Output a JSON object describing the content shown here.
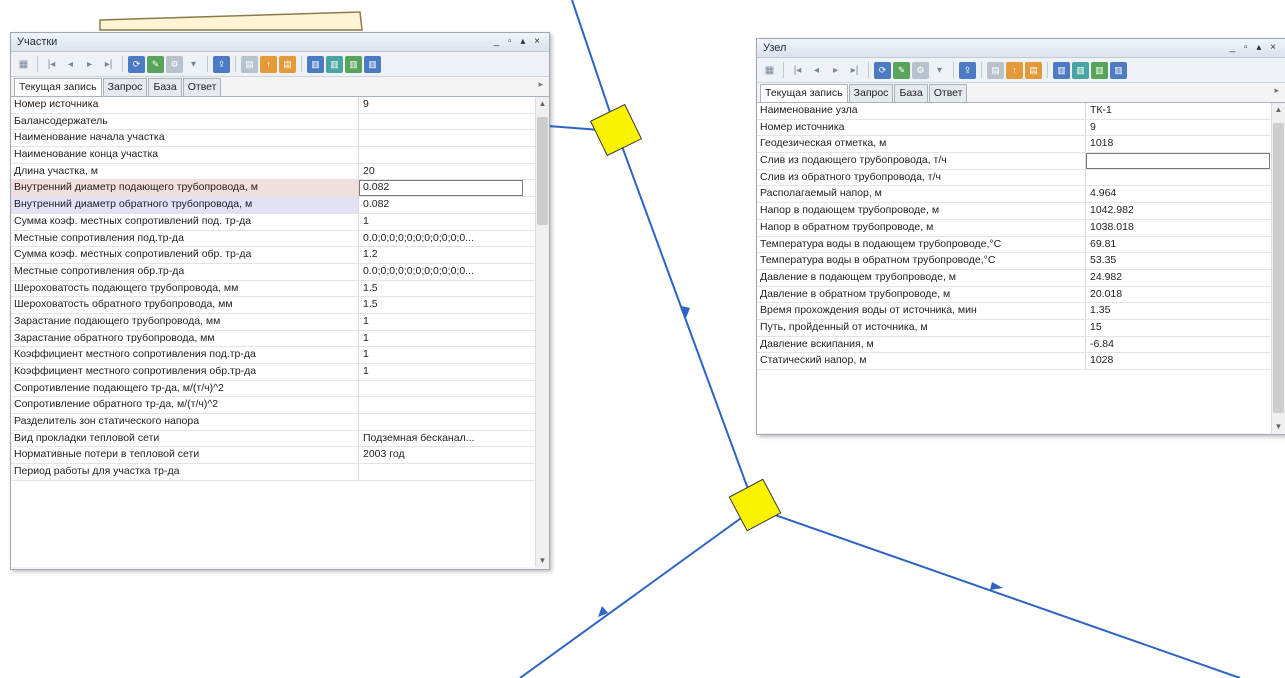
{
  "uchastki": {
    "title": "Участки",
    "controls": "_ ▫ ▴ ×",
    "tabs": [
      "Текущая запись",
      "Запрос",
      "База",
      "Ответ"
    ],
    "rows": [
      {
        "name": "Номер источника",
        "value": "9"
      },
      {
        "name": "Балансодержатель",
        "value": ""
      },
      {
        "name": "Наименование начала участка",
        "value": ""
      },
      {
        "name": "Наименование конца участка",
        "value": ""
      },
      {
        "name": "Длина участка, м",
        "value": "20"
      },
      {
        "name": "Внутренний диаметр подающего трубопровода, м",
        "value": "0.082"
      },
      {
        "name": "Внутренний диаметр обратного трубопровода, м",
        "value": "0.082"
      },
      {
        "name": "Сумма коэф. местных сопротивлений под. тр-да",
        "value": "1"
      },
      {
        "name": "Местные сопротивления под.тр-да",
        "value": "0.0;0;0;0;0;0;0;0;0;0;0..."
      },
      {
        "name": "Сумма коэф. местных сопротивлений обр. тр-да",
        "value": "1.2"
      },
      {
        "name": "Местные сопротивления обр.тр-да",
        "value": "0.0;0;0;0;0;0;0;0;0;0;0..."
      },
      {
        "name": "Шероховатость подающего трубопровода, мм",
        "value": "1.5"
      },
      {
        "name": "Шероховатость обратного трубопровода, мм",
        "value": "1.5"
      },
      {
        "name": "Зарастание подающего трубопровода, мм",
        "value": "1"
      },
      {
        "name": "Зарастание обратного трубопровода, мм",
        "value": "1"
      },
      {
        "name": "Коэффициент местного сопротивления под.тр-да",
        "value": "1"
      },
      {
        "name": "Коэффициент местного сопротивления обр.тр-да",
        "value": "1"
      },
      {
        "name": "Сопротивление подающего тр-да, м/(т/ч)^2",
        "value": ""
      },
      {
        "name": "Сопротивление обратного тр-да, м/(т/ч)^2",
        "value": ""
      },
      {
        "name": "Разделитель зон статического напора",
        "value": ""
      },
      {
        "name": "Вид прокладки тепловой сети",
        "value": "Подземная бесканал..."
      },
      {
        "name": "Нормативные потери в тепловой сети",
        "value": "2003 год"
      },
      {
        "name": "Период работы для участка тр-да",
        "value": ""
      }
    ]
  },
  "uzel": {
    "title": "Узел",
    "controls": "_ ▫ ▴ ×",
    "tabs": [
      "Текущая запись",
      "Запрос",
      "База",
      "Ответ"
    ],
    "rows": [
      {
        "name": "Наименование узла",
        "value": "ТК-1"
      },
      {
        "name": "Номер источника",
        "value": "9"
      },
      {
        "name": "Геодезическая отметка, м",
        "value": "1018"
      },
      {
        "name": "Слив из подающего трубопровода, т/ч",
        "value": ""
      },
      {
        "name": "Слив из обратного трубопровода, т/ч",
        "value": ""
      },
      {
        "name": "Располагаемый напор, м",
        "value": "4.964"
      },
      {
        "name": "Напор в подающем трубопроводе, м",
        "value": "1042.982"
      },
      {
        "name": "Напор в обратном трубопроводе, м",
        "value": "1038.018"
      },
      {
        "name": "Температура воды в подающем трубопроводе,°С",
        "value": "69.81"
      },
      {
        "name": "Температура воды в обратном трубопроводе,°С",
        "value": "53.35"
      },
      {
        "name": "Давление в подающем трубопроводе, м",
        "value": "24.982"
      },
      {
        "name": "Давление в обратном трубопроводе, м",
        "value": "20.018"
      },
      {
        "name": "Время прохождения воды от источника, мин",
        "value": "1.35"
      },
      {
        "name": "Путь, пройденный от источника, м",
        "value": "15"
      },
      {
        "name": "Давление вскипания, м",
        "value": "-6.84"
      },
      {
        "name": "Статический напор, м",
        "value": "1028"
      }
    ]
  },
  "icons": {
    "toolbar": [
      "grid-icon",
      "first-record-icon",
      "prev-record-icon",
      "next-record-icon",
      "last-record-icon",
      "refresh-icon",
      "edit-icon",
      "tools-icon",
      "dropdown-icon",
      "export-icon",
      "doc-icon",
      "doc-up-icon",
      "doc-orange-icon",
      "report-icon",
      "report-edit-icon",
      "report-green-icon",
      "report-blue-icon"
    ],
    "scroll": [
      "scroll-up-icon",
      "scroll-down-icon"
    ],
    "map": [
      "node-square-icon",
      "flow-arrow-icon"
    ]
  },
  "colors": {
    "pipe": "#2e64c4",
    "node": "#fbf200",
    "node_border": "#3a3a3a"
  }
}
